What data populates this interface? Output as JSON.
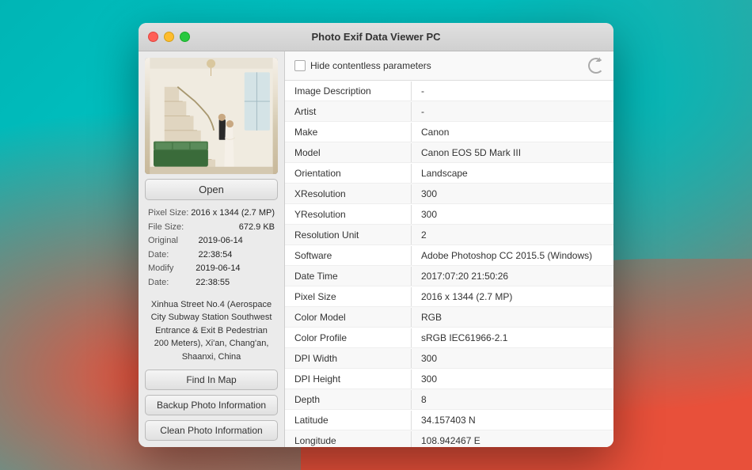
{
  "window": {
    "title": "Photo Exif Data Viewer PC",
    "traffic_lights": {
      "close": "close",
      "minimize": "minimize",
      "maximize": "maximize"
    }
  },
  "toolbar": {
    "checkbox_label": "Hide contentless parameters",
    "refresh_icon": "refresh-icon"
  },
  "left_panel": {
    "open_button": "Open",
    "pixel_size_label": "Pixel Size:",
    "pixel_size_value": "2016 x 1344 (2.7 MP)",
    "file_size_label": "File Size:",
    "file_size_value": "672.9 KB",
    "original_date_label": "Original Date:",
    "original_date_value": "2019-06-14 22:38:54",
    "modify_date_label": "Modify Date:",
    "modify_date_value": "2019-06-14 22:38:55",
    "address": "Xinhua Street No.4 (Aerospace City Subway Station Southwest Entrance & Exit B Pedestrian 200 Meters), Xi'an, Chang'an, Shaanxi, China",
    "find_in_map_button": "Find In Map",
    "backup_button": "Backup Photo Information",
    "clean_button": "Clean Photo Information"
  },
  "exif_data": {
    "rows": [
      {
        "key": "Image Description",
        "value": "-"
      },
      {
        "key": "Artist",
        "value": "-"
      },
      {
        "key": "Make",
        "value": "Canon"
      },
      {
        "key": "Model",
        "value": "Canon EOS 5D Mark III"
      },
      {
        "key": "Orientation",
        "value": "Landscape"
      },
      {
        "key": "XResolution",
        "value": "300"
      },
      {
        "key": "YResolution",
        "value": "300"
      },
      {
        "key": "Resolution Unit",
        "value": "2"
      },
      {
        "key": "Software",
        "value": "Adobe Photoshop CC 2015.5 (Windows)"
      },
      {
        "key": "Date Time",
        "value": "2017:07:20 21:50:26"
      },
      {
        "key": "Pixel Size",
        "value": "2016 x 1344 (2.7 MP)"
      },
      {
        "key": "Color Model",
        "value": "RGB"
      },
      {
        "key": "Color Profile",
        "value": "sRGB IEC61966-2.1"
      },
      {
        "key": "DPI Width",
        "value": "300"
      },
      {
        "key": "DPI Height",
        "value": "300"
      },
      {
        "key": "Depth",
        "value": "8"
      },
      {
        "key": "Latitude",
        "value": "34.157403 N"
      },
      {
        "key": "Longitude",
        "value": "108.942467 E"
      }
    ]
  }
}
